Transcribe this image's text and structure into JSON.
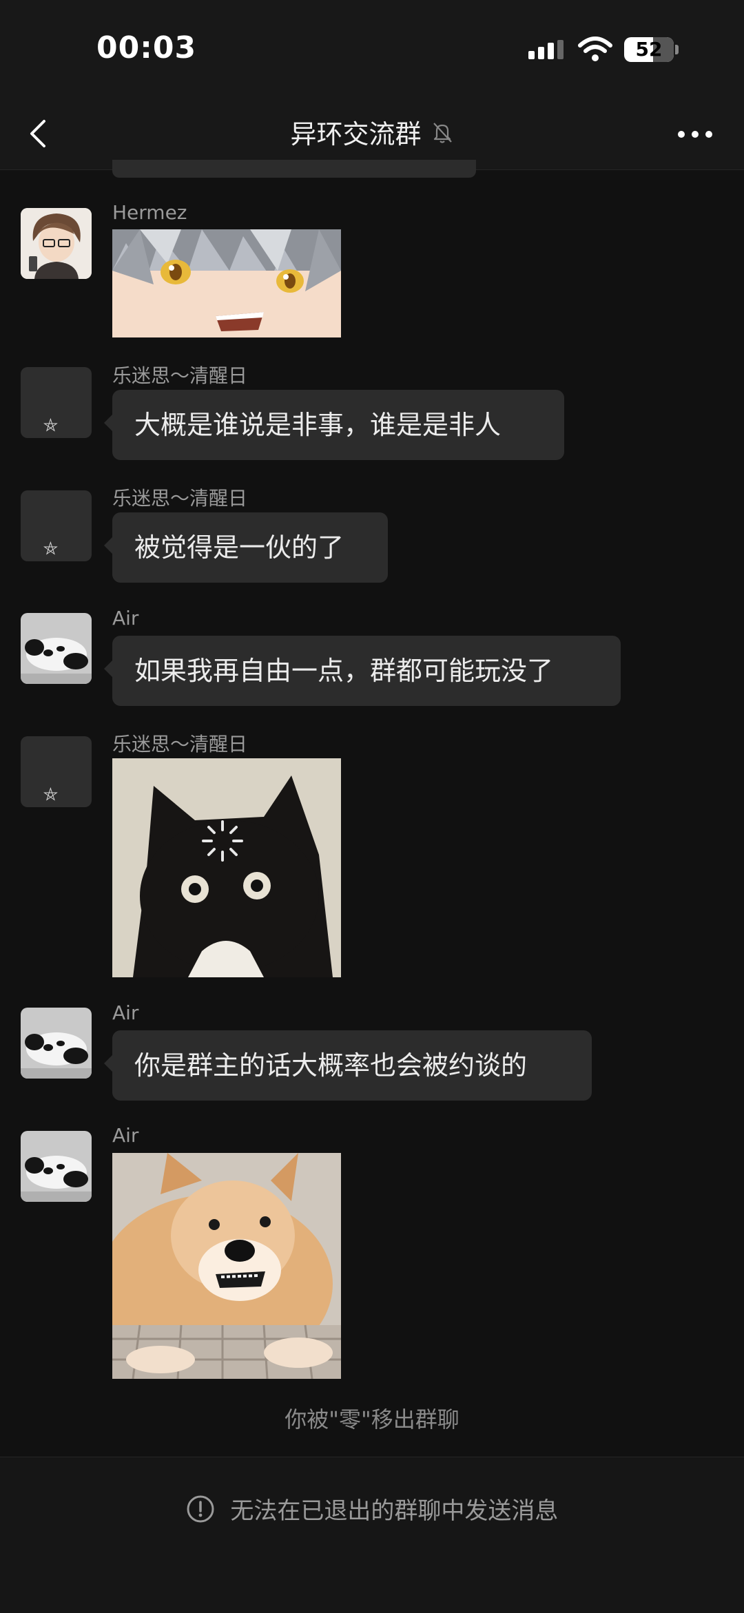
{
  "status_bar": {
    "time": "00:03",
    "battery": "52"
  },
  "nav": {
    "title": "异环交流群",
    "muted_icon": "bell-off-icon",
    "back_icon": "chevron-left-icon",
    "more_icon": "more-dots-icon"
  },
  "messages": [
    {
      "sender": "Hermez",
      "type": "image",
      "image_desc": "anime-character-sticker"
    },
    {
      "sender": "乐迷思～清醒日",
      "type": "text",
      "text": "大概是谁说是非事，谁是是非人"
    },
    {
      "sender": "乐迷思～清醒日",
      "type": "text",
      "text": "被觉得是一伙的了"
    },
    {
      "sender": "Air",
      "type": "text",
      "text": "如果我再自由一点，群都可能玩没了"
    },
    {
      "sender": "乐迷思～清醒日",
      "type": "image",
      "image_desc": "black-cat-loading-sticker"
    },
    {
      "sender": "Air",
      "type": "text",
      "text": "你是群主的话大概率也会被约谈的"
    },
    {
      "sender": "Air",
      "type": "image",
      "image_desc": "shiba-dog-sticker"
    }
  ],
  "system_message": "你被\"零\"移出群聊",
  "footer": {
    "notice": "无法在已退出的群聊中发送消息",
    "icon": "exclamation-circle-icon"
  },
  "colors": {
    "background": "#111111",
    "bubble": "#2c2c2c",
    "secondary_text": "#9a9a9a"
  }
}
